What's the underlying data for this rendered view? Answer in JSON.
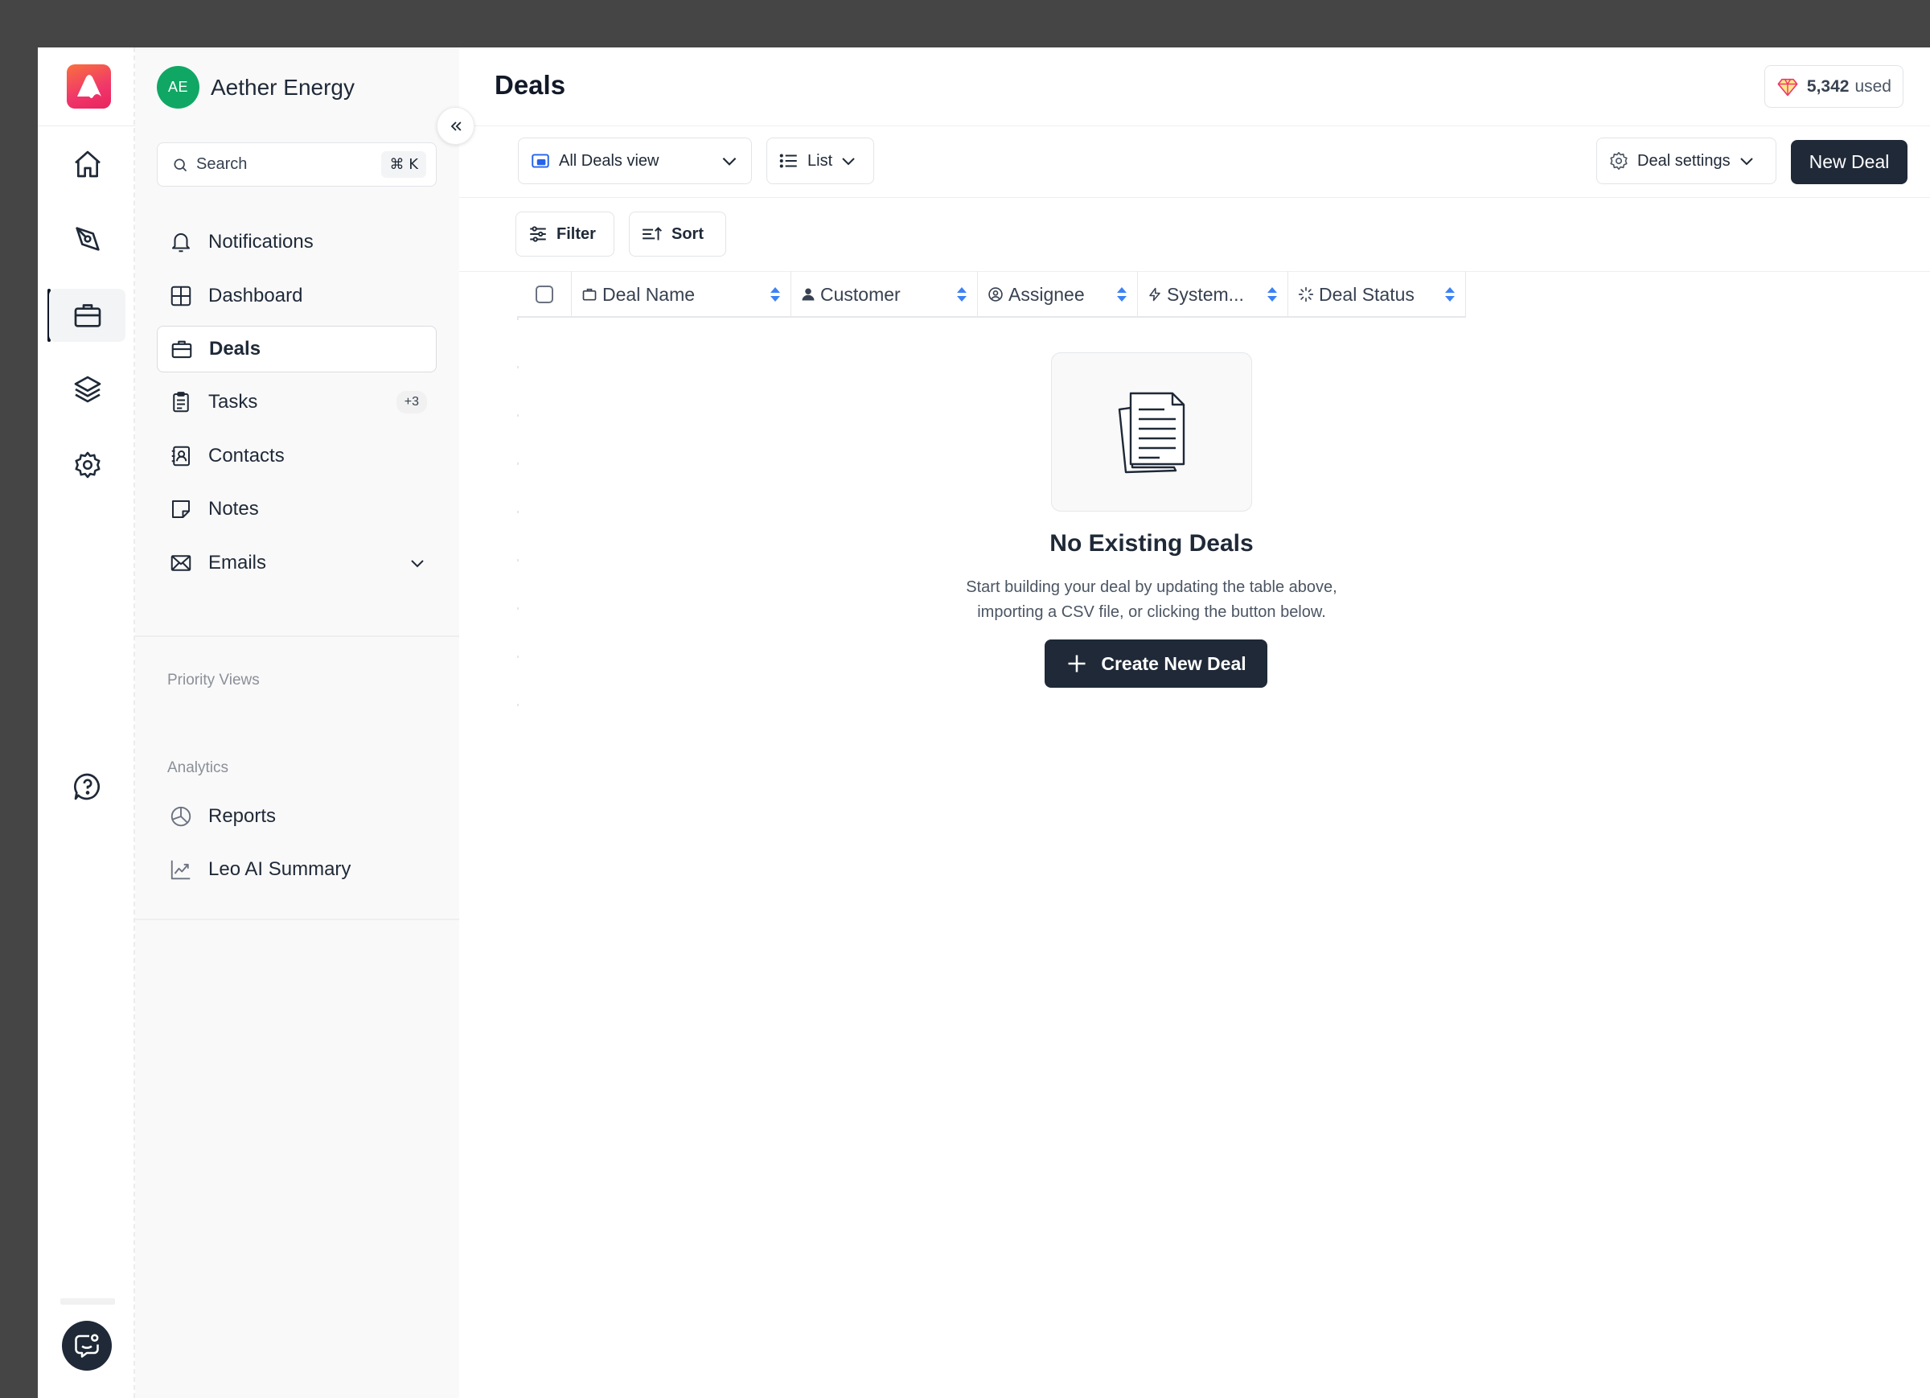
{
  "workspace": {
    "initials": "AE",
    "name": "Aether Energy"
  },
  "search": {
    "label": "Search",
    "shortcut": "⌘ K"
  },
  "nav": {
    "notifications": "Notifications",
    "dashboard": "Dashboard",
    "deals": "Deals",
    "tasks": "Tasks",
    "tasks_badge": "+3",
    "contacts": "Contacts",
    "notes": "Notes",
    "emails": "Emails"
  },
  "sections": {
    "priority_views": "Priority Views",
    "analytics": "Analytics"
  },
  "analytics": {
    "reports": "Reports",
    "leo": "Leo AI Summary"
  },
  "header": {
    "title": "Deals",
    "credits_value": "5,342",
    "credits_suffix": "used"
  },
  "toolbar": {
    "view_label": "All Deals view",
    "layout_label": "List",
    "settings_label": "Deal settings",
    "new_deal_label": "New Deal",
    "filter_label": "Filter",
    "sort_label": "Sort"
  },
  "table": {
    "columns": [
      "Deal Name",
      "Customer",
      "Assignee",
      "System...",
      "Deal Status"
    ]
  },
  "empty_state": {
    "title": "No Existing Deals",
    "line1": "Start building your deal by updating the table above,",
    "line2": "importing a CSV file, or clicking the button below.",
    "button": "Create New Deal"
  },
  "colors": {
    "accent_dark": "#1f2937",
    "avatar_green": "#10a765",
    "sort_blue": "#3b82f6",
    "logo_gradient_start": "#f9703e",
    "logo_gradient_end": "#e8245f"
  }
}
